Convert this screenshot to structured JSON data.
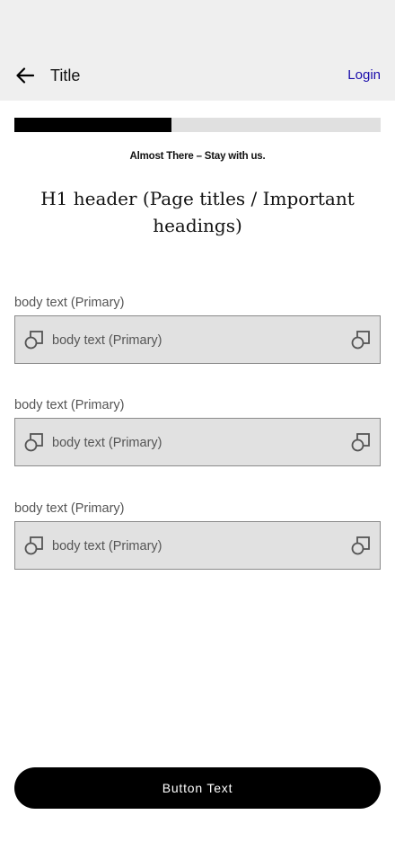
{
  "header": {
    "title": "Title",
    "login_label": "Login",
    "back_icon": "arrow-left-icon"
  },
  "progress": {
    "fraction": 0.43,
    "caption": "Almost There – Stay with us."
  },
  "heading": "H1 header (Page titles / Important headings)",
  "fields": [
    {
      "label": "body text (Primary)",
      "placeholder": "body text (Primary)",
      "left_icon": "shapes-icon",
      "right_icon": "shapes-icon"
    },
    {
      "label": "body text (Primary)",
      "placeholder": "body text (Primary)",
      "left_icon": "shapes-icon",
      "right_icon": "shapes-icon"
    },
    {
      "label": "body text (Primary)",
      "placeholder": "body text (Primary)",
      "left_icon": "shapes-icon",
      "right_icon": "shapes-icon"
    }
  ],
  "button": {
    "label": "Button Text"
  },
  "colors": {
    "accent_link": "#1a0dab",
    "bar_background": "#efefef",
    "progress_fill": "#000000",
    "field_background": "#e1e1e1"
  }
}
